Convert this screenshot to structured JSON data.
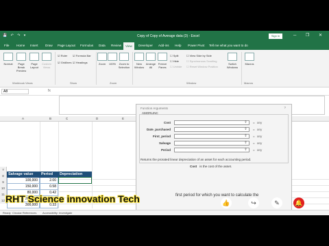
{
  "window": {
    "title": "Copy of Copy of Average data (3) - Excel",
    "sign_in": "Sign in",
    "quick_access": "💾 ↶ ↷ ▾",
    "window_controls": "─ ❐ ✕"
  },
  "tabs": [
    "File",
    "Home",
    "Insert",
    "Draw",
    "Page Layout",
    "Formulas",
    "Data",
    "Review",
    "View",
    "Developer",
    "Add-ins",
    "Help",
    "Power Pivot",
    "Tell me what you want to do"
  ],
  "active_tab": "View",
  "ribbon": {
    "workbook_views": [
      "Normal",
      "Page Break Preview",
      "Page Layout",
      "Custom Views"
    ],
    "show": [
      "Ruler",
      "Formula Bar",
      "Gridlines",
      "Headings"
    ],
    "zoom": [
      "Zoom",
      "100%",
      "Zoom to Selection"
    ],
    "window": [
      "New Window",
      "Arrange All",
      "Freeze Panes",
      "Split",
      "Hide",
      "Unhide",
      "View Side by Side",
      "Synchronous Scrolling",
      "Reset Window Position",
      "Switch Windows"
    ],
    "macros": [
      "Macros"
    ],
    "groups": [
      "Workbook Views",
      "Show",
      "Zoom",
      "Window",
      "Macros"
    ]
  },
  "formula_bar": {
    "name_box": "A8",
    "fx": "fx"
  },
  "columns": [
    "A",
    "B",
    "C",
    "D",
    "E"
  ],
  "rows": [
    "7",
    "8",
    "9",
    "10",
    "11",
    "12",
    "13",
    "14"
  ],
  "table": {
    "headers": [
      "Salvage value",
      "Period",
      "Depreciation"
    ],
    "rows": [
      [
        "100,000",
        "2.00"
      ],
      [
        "150,000",
        "0.58"
      ],
      [
        "80,000",
        "0.42"
      ],
      [
        "200,000",
        "0.92"
      ],
      [
        "300,000",
        "0.33"
      ]
    ]
  },
  "dialog": {
    "title": "Function Arguments",
    "close": "?",
    "function": "AMORLINC",
    "args": [
      {
        "label": "Cost",
        "value": "",
        "eq": "=",
        "type": "any"
      },
      {
        "label": "Date_purchased",
        "value": "",
        "eq": "=",
        "type": "any"
      },
      {
        "label": "First_period",
        "value": "",
        "eq": "=",
        "type": "any"
      },
      {
        "label": "Salvage",
        "value": "",
        "eq": "=",
        "type": "any"
      },
      {
        "label": "Period",
        "value": "",
        "eq": "=",
        "type": "any"
      }
    ],
    "description": "Returns the prorated linear depreciation of an asset for each accounting period.",
    "arg_name": "Cost",
    "arg_description": "is the cost of the asset."
  },
  "status_bar": {
    "ready": "Ready",
    "circular": "Circular References",
    "accessibility": "Accessibility: Investigate"
  },
  "overlay": {
    "channel": "RHT Science innovation Tech",
    "underlying": "first period for which you want to calculate the"
  },
  "colors": {
    "excel_green": "#217346",
    "table_header": "#1f4e79",
    "overlay_yellow": "#ffe94a",
    "subscribe_red": "#e02020"
  }
}
